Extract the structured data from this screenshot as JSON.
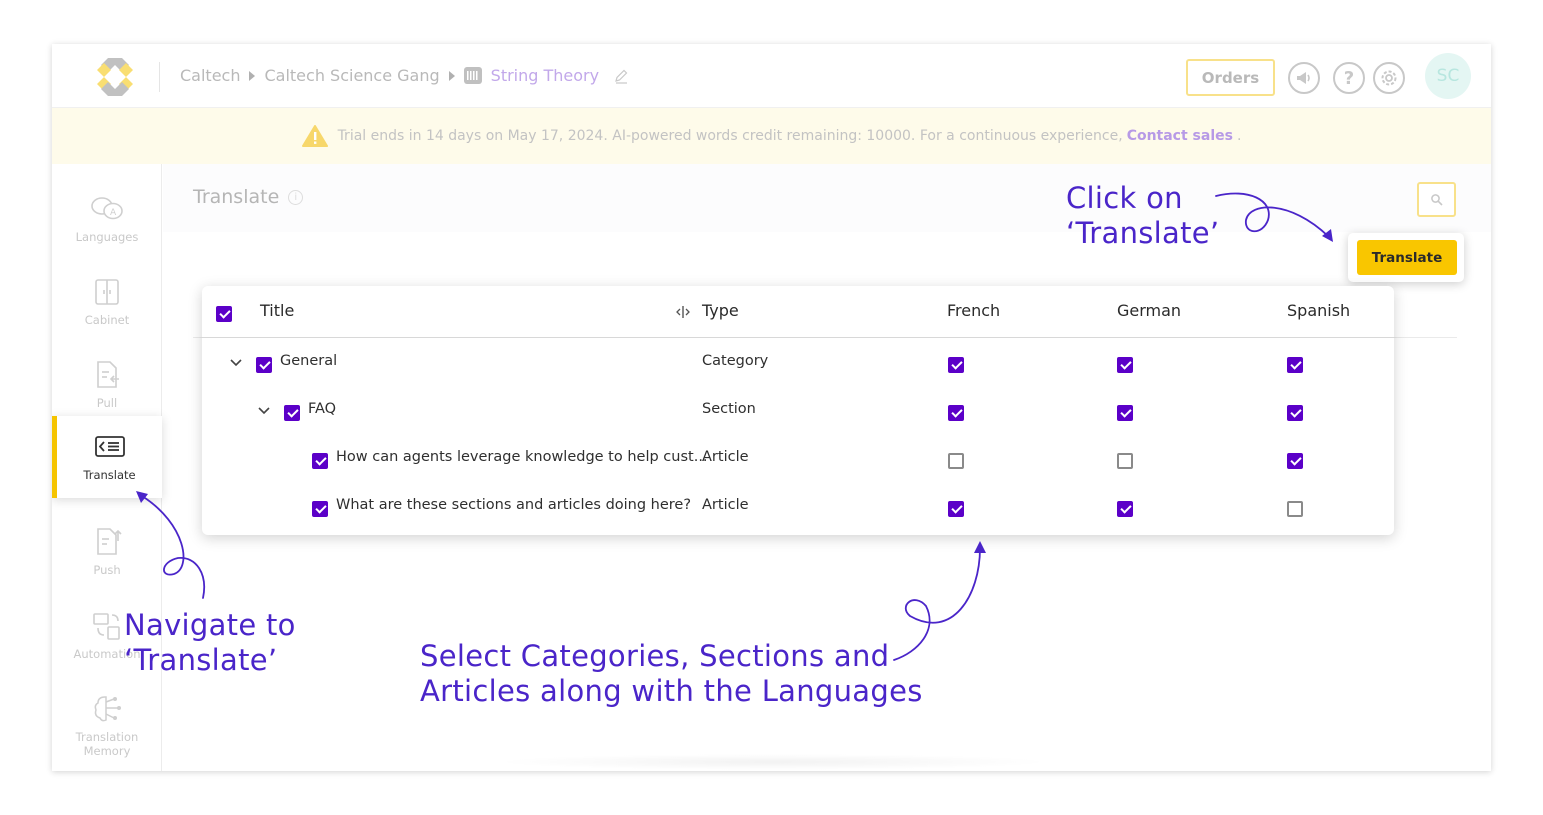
{
  "breadcrumb": {
    "items": [
      "Caltech",
      "Caltech Science Gang"
    ],
    "current": "String Theory"
  },
  "header": {
    "orders_label": "Orders",
    "avatar_initials": "SC"
  },
  "banner": {
    "text": "Trial ends in 14 days on May 17, 2024. AI-powered words credit remaining: 10000. For a continuous experience,",
    "link": "Contact sales",
    "suffix": "."
  },
  "sidebar": {
    "items": [
      {
        "label": "Languages",
        "icon": "languages-icon"
      },
      {
        "label": "Cabinet",
        "icon": "cabinet-icon"
      },
      {
        "label": "Pull",
        "icon": "pull-icon"
      },
      {
        "label": "Translate",
        "icon": "translate-icon",
        "active": true
      },
      {
        "label": "Push",
        "icon": "push-icon"
      },
      {
        "label": "Automation",
        "icon": "automation-icon"
      },
      {
        "label": "Translation Memory",
        "icon": "translation-memory-icon"
      }
    ]
  },
  "page": {
    "title": "Translate",
    "translate_button": "Translate"
  },
  "table": {
    "columns": [
      "Title",
      "Type",
      "French",
      "German",
      "Spanish"
    ],
    "header_checked": true,
    "rows": [
      {
        "title": "General",
        "type": "Category",
        "checked": true,
        "expanded": true,
        "french": true,
        "german": true,
        "spanish": true
      },
      {
        "title": "FAQ",
        "type": "Section",
        "checked": true,
        "expanded": true,
        "french": true,
        "german": true,
        "spanish": true
      },
      {
        "title": "How can agents leverage knowledge to help cust...",
        "type": "Article",
        "checked": true,
        "french": false,
        "german": false,
        "spanish": true
      },
      {
        "title": "What are these sections and articles doing here?",
        "type": "Article",
        "checked": true,
        "french": true,
        "german": true,
        "spanish": false
      }
    ]
  },
  "annotations": {
    "click_line1": "Click on",
    "click_line2": "‘Translate’",
    "navigate_line1": "Navigate to",
    "navigate_line2": "‘Translate’",
    "select_line1": "Select Categories, Sections and",
    "select_line2": "Articles along with the Languages"
  },
  "colors": {
    "accent": "#5b00c8",
    "brand_yellow": "#f9c600",
    "annotation": "#4a25c9"
  }
}
